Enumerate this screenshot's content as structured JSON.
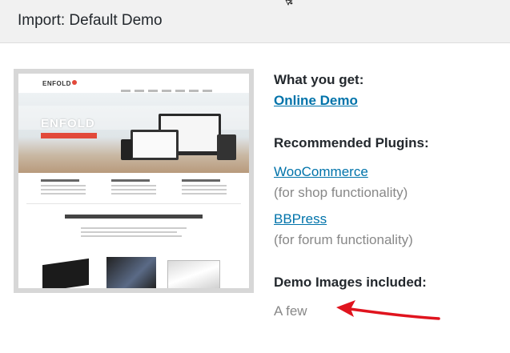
{
  "header": {
    "title": "Import: Default Demo"
  },
  "what_you_get": {
    "label": "What you get:",
    "link": "Online Demo"
  },
  "plugins": {
    "label": "Recommended Plugins:",
    "items": [
      {
        "name": "WooCommerce",
        "note": "(for shop functionality)"
      },
      {
        "name": "BBPress",
        "note": "(for forum functionality)"
      }
    ]
  },
  "images": {
    "label": "Demo Images included:",
    "value": "A few"
  },
  "preview": {
    "logo": "ENFOLD",
    "hero_title": "ENFOLD"
  },
  "colors": {
    "link": "#0073aa",
    "annotation_arrow": "#e0141e",
    "header_bg": "#f1f1f1"
  }
}
